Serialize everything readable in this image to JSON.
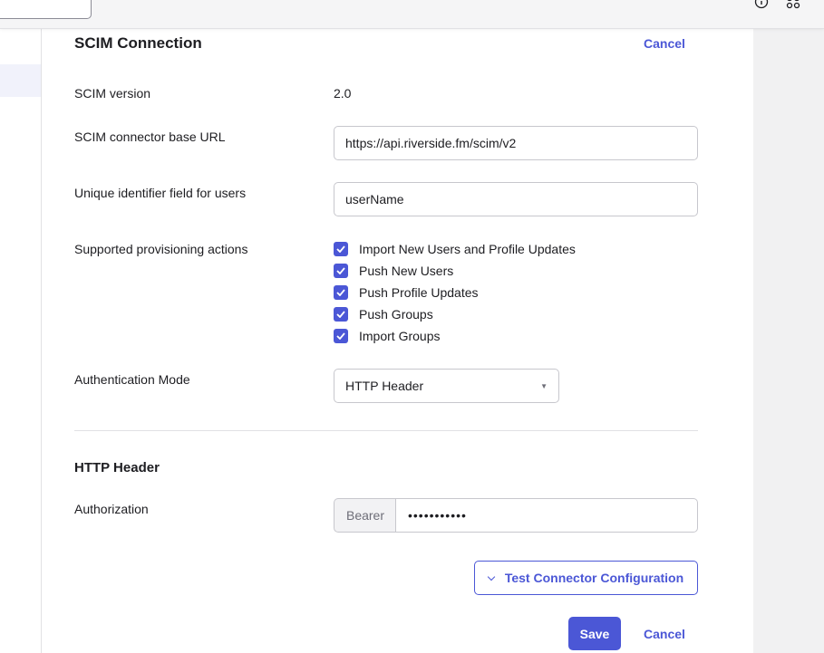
{
  "header": {
    "title": "SCIM Connection",
    "cancel_label": "Cancel",
    "help_icon": "help-circle-icon",
    "apps_icon": "apps-grid-icon"
  },
  "fields": {
    "scim_version": {
      "label": "SCIM version",
      "value": "2.0"
    },
    "base_url": {
      "label": "SCIM connector base URL",
      "value": "https://api.riverside.fm/scim/v2"
    },
    "unique_id": {
      "label": "Unique identifier field for users",
      "value": "userName"
    },
    "provisioning": {
      "label": "Supported provisioning actions",
      "items": [
        {
          "label": "Import New Users and Profile Updates",
          "checked": true
        },
        {
          "label": "Push New Users",
          "checked": true
        },
        {
          "label": "Push Profile Updates",
          "checked": true
        },
        {
          "label": "Push Groups",
          "checked": true
        },
        {
          "label": "Import Groups",
          "checked": true
        }
      ]
    },
    "auth_mode": {
      "label": "Authentication Mode",
      "value": "HTTP Header"
    }
  },
  "http_header": {
    "title": "HTTP Header",
    "authorization": {
      "label": "Authorization",
      "prefix": "Bearer",
      "value": "•••••••••••"
    }
  },
  "actions": {
    "test_label": "Test Connector Configuration",
    "save_label": "Save",
    "cancel_label": "Cancel"
  },
  "colors": {
    "accent": "#4b57d6"
  }
}
